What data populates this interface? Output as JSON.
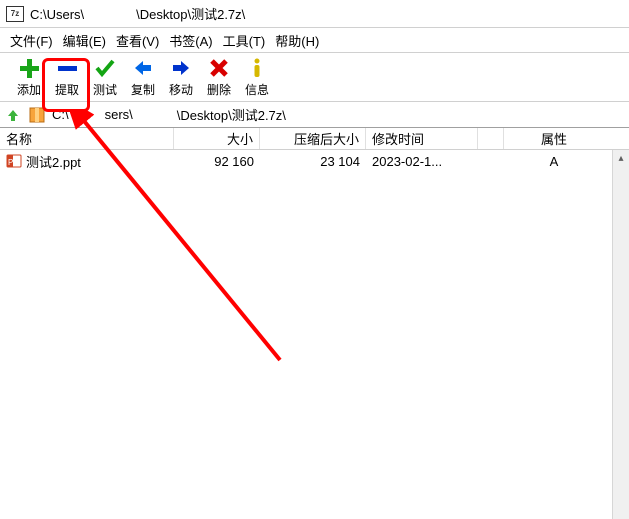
{
  "title": {
    "icon_label": "7z",
    "path_prefix": "C:\\Users\\",
    "path_suffix": "\\Desktop\\测试2.7z\\"
  },
  "menu": {
    "file": "文件(F)",
    "edit": "编辑(E)",
    "view": "查看(V)",
    "favorites": "书签(A)",
    "tools": "工具(T)",
    "help": "帮助(H)"
  },
  "toolbar": {
    "add": "添加",
    "extract": "提取",
    "test": "测试",
    "copy": "复制",
    "move": "移动",
    "delete": "删除",
    "info": "信息"
  },
  "address": {
    "prefix": "C:\\",
    "mid": "sers\\",
    "suffix": "\\Desktop\\测试2.7z\\"
  },
  "columns": {
    "name": "名称",
    "size": "大小",
    "packed": "压缩后大小",
    "modified": "修改时间",
    "attributes": "属性"
  },
  "rows": [
    {
      "icon": "ppt",
      "name": "测试2.ppt",
      "size": "92 160",
      "packed": "23 104",
      "modified": "2023-02-1...",
      "attributes": "A"
    }
  ]
}
